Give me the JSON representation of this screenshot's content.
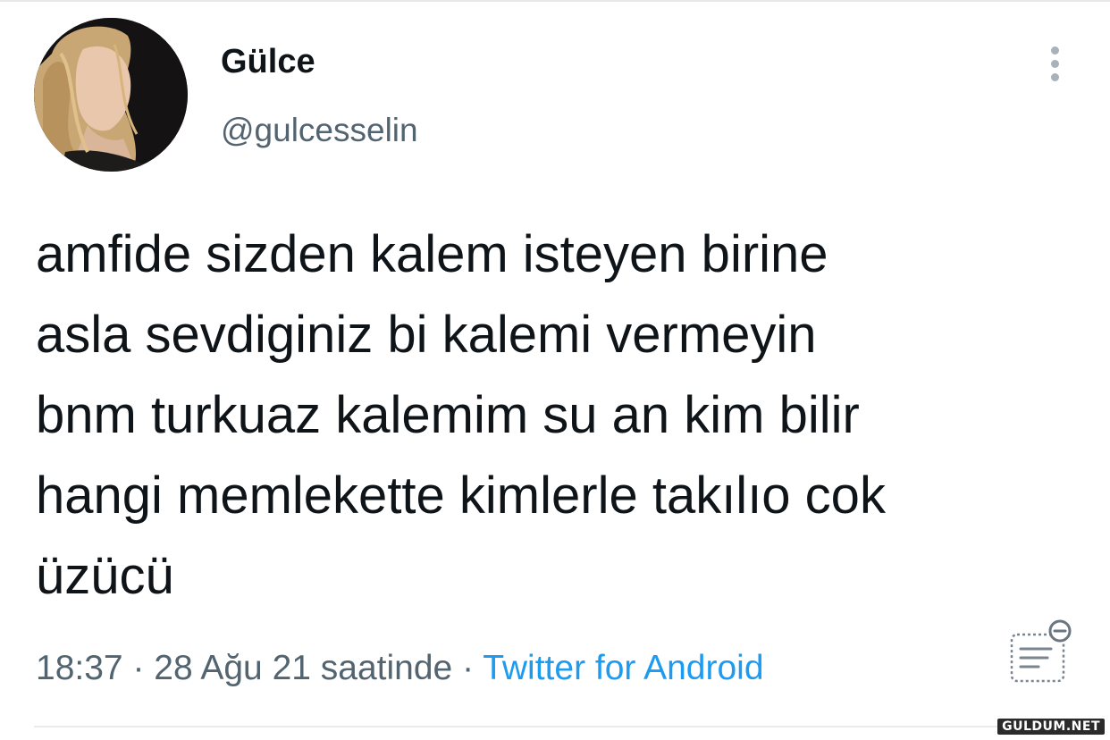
{
  "user": {
    "display_name": "Gülce",
    "handle": "@gulcesselin"
  },
  "tweet": {
    "lines": [
      "amfide sizden kalem isteyen birine",
      "asla sevdiginiz bi kalemi vermeyin",
      "bnm turkuaz kalemim su an kim bilir",
      "hangi memlekette kimlerle takılıo cok",
      "üzücü"
    ]
  },
  "meta": {
    "time": "18:37",
    "separator": " · ",
    "date": "28 Ağu 21 saatinde",
    "source": "Twitter for Android"
  },
  "watermark": "GULDUM.NET",
  "icons": {
    "more": "more-vertical-icon",
    "reader": "reader-mode-icon"
  },
  "colors": {
    "text": "#0f1419",
    "secondary": "#536471",
    "link": "#1d9bf0"
  }
}
